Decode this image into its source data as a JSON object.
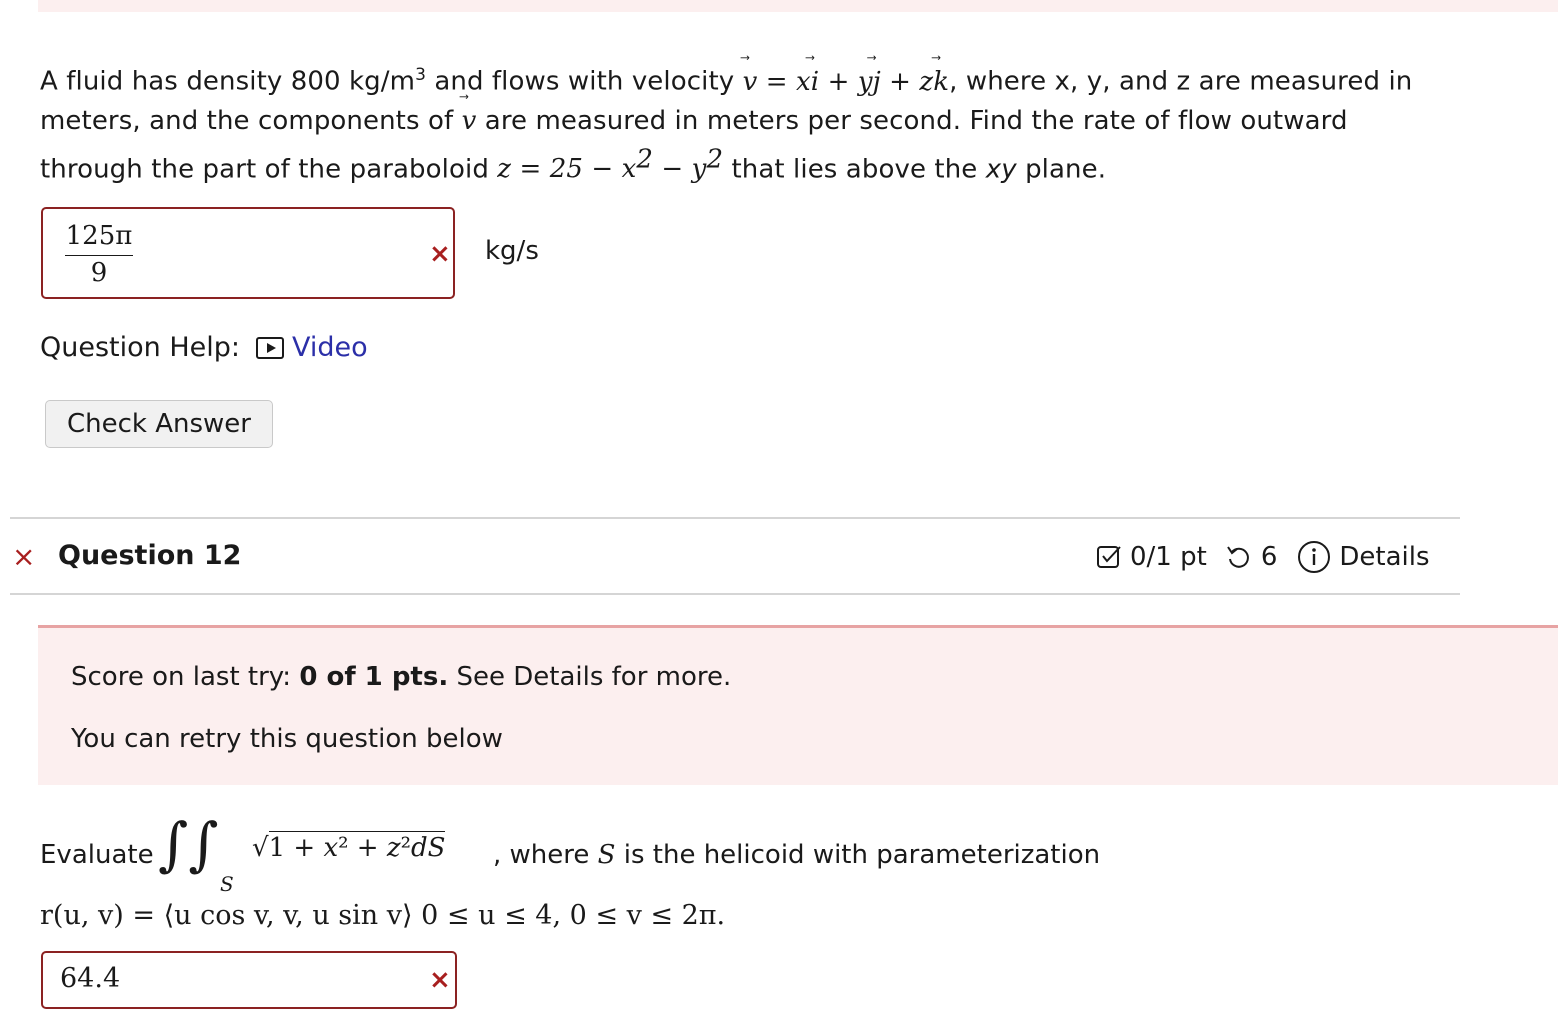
{
  "q11": {
    "text_part1": "A fluid has density 800 kg/m",
    "text_sup": "3",
    "text_part2": " and flows with velocity ",
    "velocity_expr": "v = xi + yj + zk",
    "text_part3": ", where x, y, and z are measured in",
    "line2_a": "meters, and the components of ",
    "line2_b": " are measured in meters per second. Find the rate of flow outward",
    "line3_a": "through the part of the paraboloid ",
    "paraboloid_expr": "z = 25 − x² − y²",
    "line3_b": " that lies above the ",
    "line3_xy": "xy",
    "line3_c": " plane.",
    "answer_numerator": "125π",
    "answer_denominator": "9",
    "answer_status": "×",
    "unit": "kg/s",
    "help_label": "Question Help:",
    "video_label": "Video",
    "check_answer_label": "Check Answer"
  },
  "q12": {
    "status_mark": "×",
    "title": "Question 12",
    "points": "0/1 pt",
    "retries": "6",
    "details_label": "Details",
    "score_prefix": "Score on last try: ",
    "score_bold": "0 of 1 pts.",
    "score_suffix": " See Details for more.",
    "retry_text": "You can retry this question below",
    "evaluate_label": "Evaluate",
    "integrand": "1 + x² + z²dS",
    "surface_sub": "S",
    "after_integral": ", where S is the helicoid with parameterization",
    "param_line": "r(u, v) = ⟨u cos v, v, u sin v⟩  0 ≤ u ≤ 4,  0 ≤ v ≤ 2π.",
    "answer_value": "64.4",
    "answer_status": "×"
  },
  "colors": {
    "error_red": "#a81f1f",
    "link_blue": "#2b2fa8",
    "panel_pink": "#fcefef",
    "panel_border": "#e7a3a3"
  },
  "icons": [
    "video-play-icon",
    "checkbox-icon",
    "retry-icon",
    "info-icon",
    "close-icon"
  ]
}
